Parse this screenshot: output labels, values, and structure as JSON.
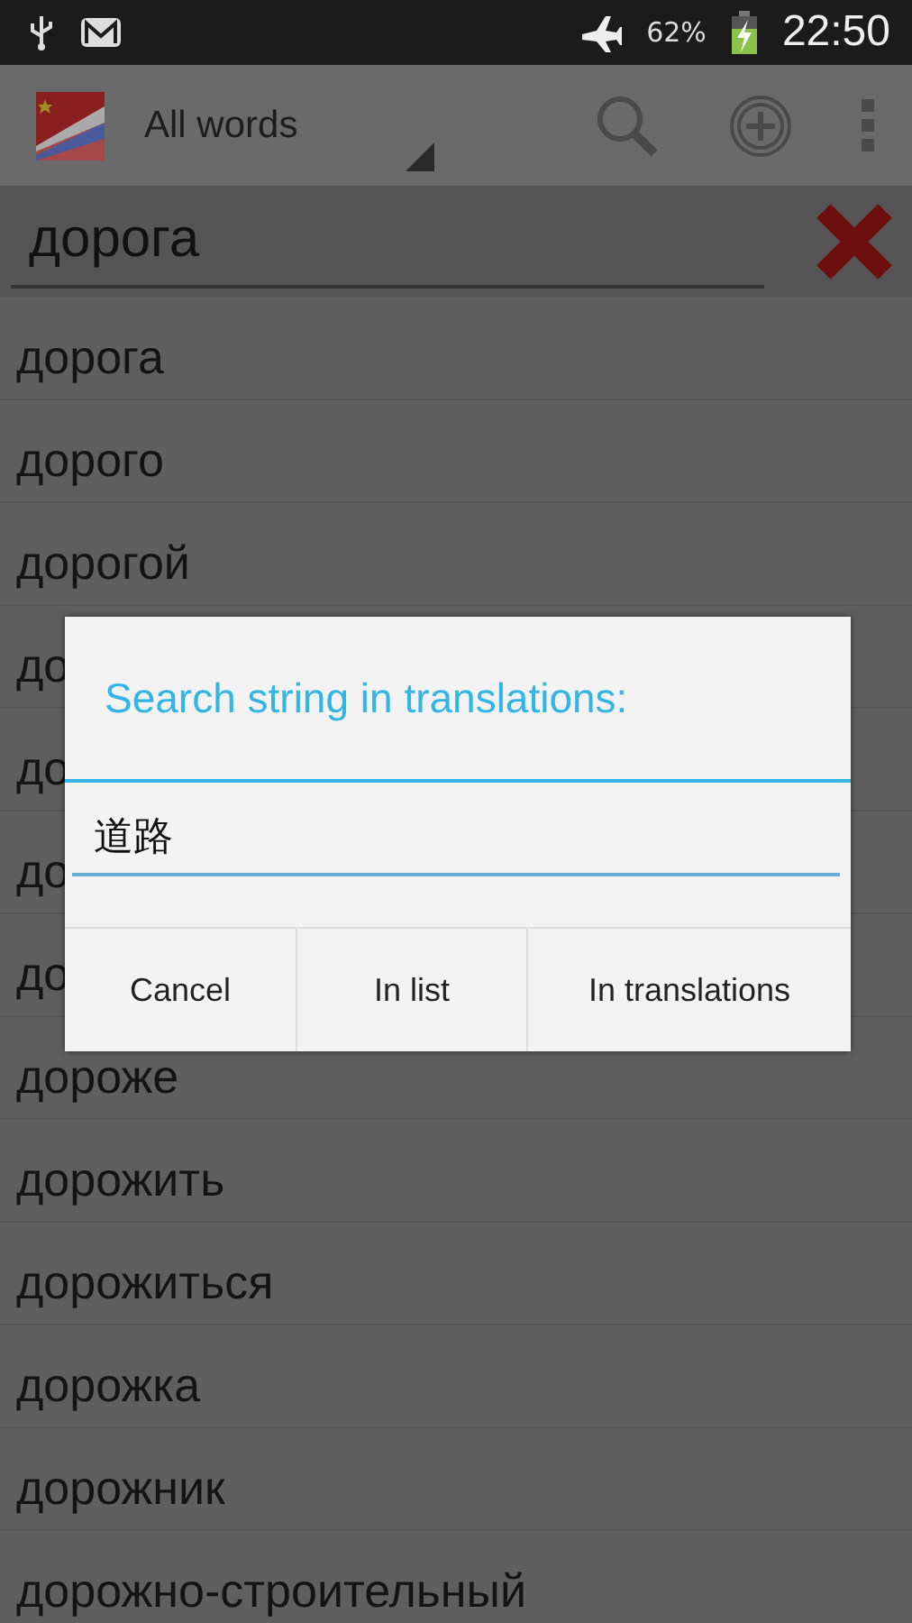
{
  "status_bar": {
    "battery_percent": "62%",
    "time": "22:50"
  },
  "action_bar": {
    "filter": "All words"
  },
  "search": {
    "value": "дорога"
  },
  "words": [
    "дорога",
    "дорого",
    "дорогой",
    "до",
    "до",
    "до",
    "до",
    "дороже",
    "дорожить",
    "дорожиться",
    "дорожка",
    "дорожник",
    "дорожно-строительный"
  ],
  "dialog": {
    "title": "Search string in translations:",
    "input": {
      "value": "道路"
    },
    "buttons": [
      "Cancel",
      "In list",
      "In translations"
    ]
  }
}
